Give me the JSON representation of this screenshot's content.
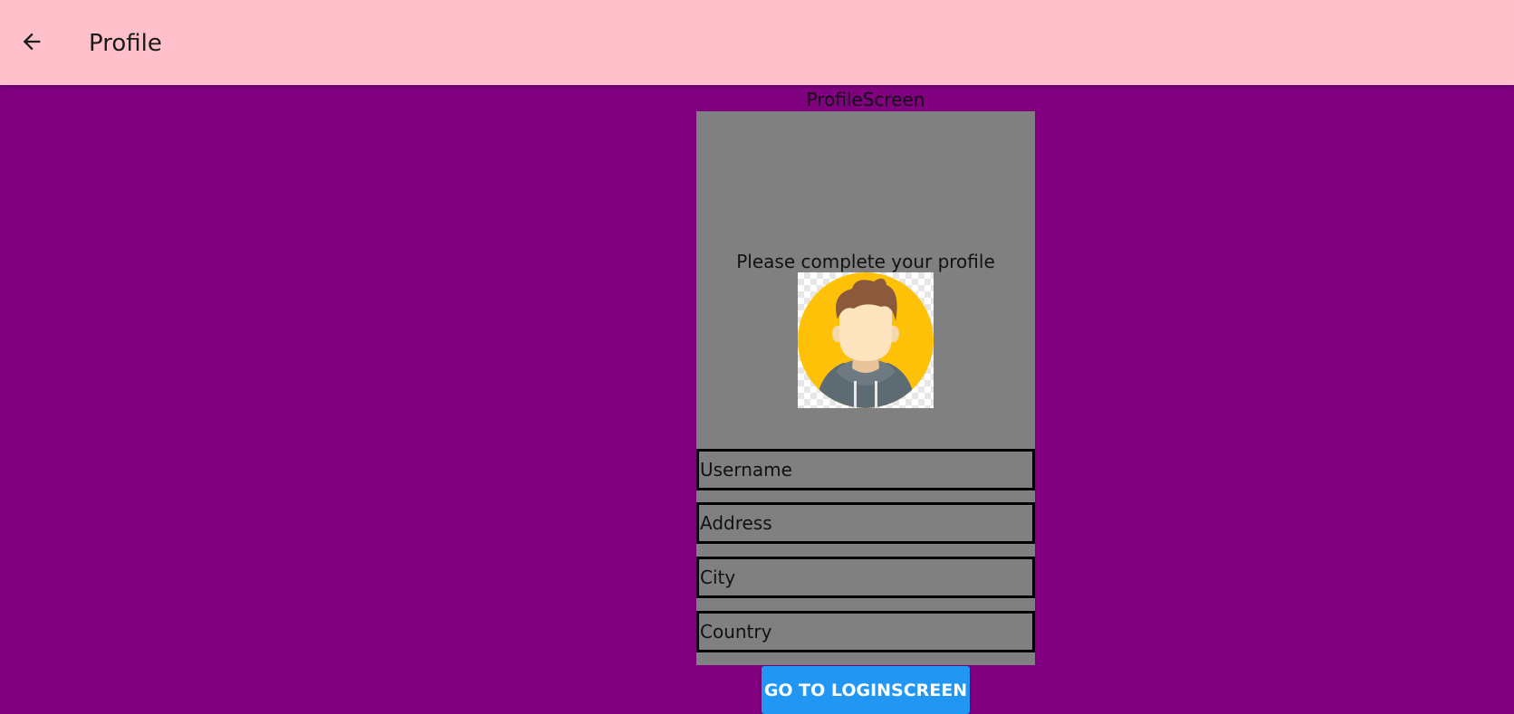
{
  "appbar": {
    "title": "Profile",
    "back_icon": "arrow-left-icon",
    "background": "#ffc0cb"
  },
  "page": {
    "background": "#800080",
    "screen_label": "ProfileScreen"
  },
  "profile_panel": {
    "background": "#808080",
    "prompt": "Please complete your profile",
    "avatar_icon": "user-avatar-icon",
    "fields": [
      {
        "name": "username",
        "placeholder": "Username",
        "value": ""
      },
      {
        "name": "address",
        "placeholder": "Address",
        "value": ""
      },
      {
        "name": "city",
        "placeholder": "City",
        "value": ""
      },
      {
        "name": "country",
        "placeholder": "Country",
        "value": ""
      }
    ]
  },
  "actions": {
    "login_button_label": "GO TO LOGINSCREEN",
    "login_button_color": "#2196f3"
  }
}
